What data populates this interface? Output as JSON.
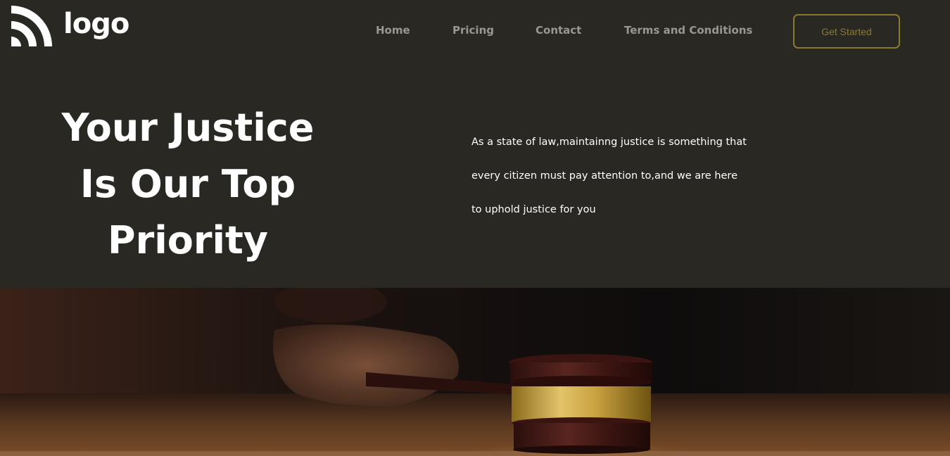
{
  "header": {
    "logo_text": "logo",
    "nav": [
      {
        "label": "Home"
      },
      {
        "label": "Pricing"
      },
      {
        "label": "Contact"
      },
      {
        "label": "Terms and Conditions"
      }
    ],
    "cta_label": "Get Started"
  },
  "hero": {
    "title_lines": [
      "Your Justice",
      "Is Our Top",
      "Priority"
    ],
    "description_lines": [
      "As a state of law,maintainng justice is something that",
      "every citizen must pay attention to,and we are here",
      "to uphold justice for you"
    ]
  },
  "colors": {
    "background": "#2a2823",
    "accent": "#8a7a2e",
    "nav_text": "#9a9791",
    "text": "#ffffff"
  },
  "icons": {
    "logo": "signal-waves-icon"
  }
}
